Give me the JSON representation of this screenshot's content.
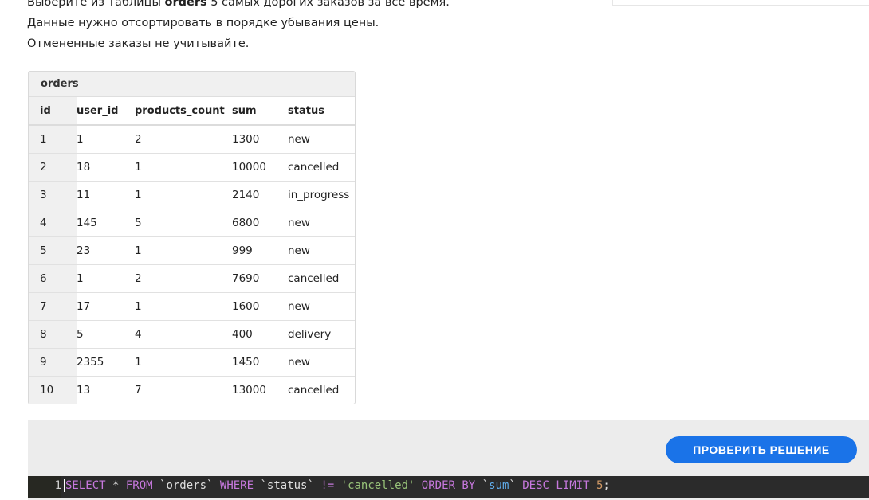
{
  "task": {
    "line1_prefix": "Выберите из таблицы ",
    "line1_bold": "orders",
    "line1_suffix": " 5 самых дорогих заказов за всё время.",
    "line2": "Данные нужно отсортировать в порядке убывания цены.",
    "line3": "Отмененные заказы не учитывайте."
  },
  "table": {
    "name": "orders",
    "columns": [
      "id",
      "user_id",
      "products_count",
      "sum",
      "status"
    ],
    "rows": [
      [
        "1",
        "1",
        "2",
        "1300",
        "new"
      ],
      [
        "2",
        "18",
        "1",
        "10000",
        "cancelled"
      ],
      [
        "3",
        "11",
        "1",
        "2140",
        "in_progress"
      ],
      [
        "4",
        "145",
        "5",
        "6800",
        "new"
      ],
      [
        "5",
        "23",
        "1",
        "999",
        "new"
      ],
      [
        "6",
        "1",
        "2",
        "7690",
        "cancelled"
      ],
      [
        "7",
        "17",
        "1",
        "1600",
        "new"
      ],
      [
        "8",
        "5",
        "4",
        "400",
        "delivery"
      ],
      [
        "9",
        "2355",
        "1",
        "1450",
        "new"
      ],
      [
        "10",
        "13",
        "7",
        "13000",
        "cancelled"
      ]
    ]
  },
  "editor": {
    "check_button": "ПРОВЕРИТЬ РЕШЕНИЕ",
    "line_number": "1",
    "tokens": {
      "t1": "SELECT",
      "t2": " * ",
      "t3": "FROM",
      "t4": " `orders` ",
      "t5": "WHERE",
      "t6": " `status` ",
      "t7": "!=",
      "t8": " ",
      "t9": "'cancelled'",
      "t10": " ",
      "t11": "ORDER BY",
      "t12": " `",
      "t13": "sum",
      "t14": "` ",
      "t15": "DESC LIMIT",
      "t16": " ",
      "t17": "5",
      "t18": ";"
    }
  },
  "colors": {
    "button": "#1a73e8",
    "keyword": "#c678dd",
    "string": "#98c379",
    "number": "#d19a66",
    "editor_bg": "#2b2b2b"
  }
}
